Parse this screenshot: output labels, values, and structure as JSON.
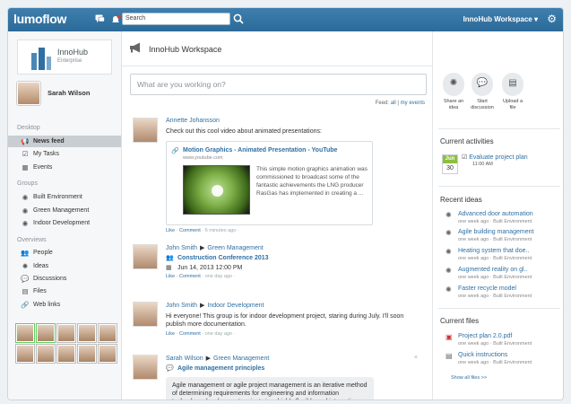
{
  "topbar": {
    "logo": "lumoflow",
    "search_placeholder": "Search",
    "workspace_menu": "InnoHub Workspace ▾",
    "notification_count": ""
  },
  "brand": {
    "name": "InnoHub",
    "sub": "Enterprise"
  },
  "user": {
    "name": "Sarah Wilson"
  },
  "nav": {
    "desktop_label": "Desktop",
    "desktop_items": [
      {
        "label": "News feed",
        "icon": "megaphone-icon"
      },
      {
        "label": "My Tasks",
        "icon": "check-icon"
      },
      {
        "label": "Events",
        "icon": "calendar-icon"
      }
    ],
    "groups_label": "Groups",
    "group_items": [
      {
        "label": "Built Environment"
      },
      {
        "label": "Green Management"
      },
      {
        "label": "Indoor Development"
      }
    ],
    "overviews_label": "Overviews",
    "overview_items": [
      {
        "label": "People",
        "icon": "people-icon"
      },
      {
        "label": "Ideas",
        "icon": "lightbulb-icon"
      },
      {
        "label": "Discussions",
        "icon": "chat-icon"
      },
      {
        "label": "Files",
        "icon": "file-icon"
      },
      {
        "label": "Web links",
        "icon": "link-icon"
      }
    ]
  },
  "main": {
    "workspace_title": "InnoHub Workspace",
    "post_placeholder": "What are you working on?",
    "feed_prefix": "Feed:",
    "feed_all": "all",
    "feed_sep": "|",
    "feed_my": "my events",
    "posts": [
      {
        "author": "Annette Johansson",
        "text": "Check out this cool video about animated presentations:",
        "link_title": "Motion Graphics - Animated Presentation - YouTube",
        "link_url": "www.youtube.com",
        "link_desc": "This simple motion graphics animation was commissioned to broadcast some of the fantastic achievements the LNG producer RasGas has implemented in creating a ...",
        "like": "Like",
        "comment": "Comment",
        "time": "· 6 minutes ago ·"
      },
      {
        "author": "John Smith",
        "group": "Green Management",
        "event_title": "Construction Conference 2013",
        "event_date": "Jun 14, 2013 12:00 PM",
        "like": "Like",
        "comment": "Comment",
        "time": "· one day ago ·"
      },
      {
        "author": "John Smith",
        "group": "Indoor Development",
        "text": "Hi everyone! This group is for indoor development project, staring during July. I'll soon publish more documentation.",
        "like": "Like",
        "comment": "Comment",
        "time": "· one day ago ·"
      },
      {
        "author": "Sarah Wilson",
        "group": "Green Management",
        "topic": "Agile management principles",
        "quote": "Agile management or agile project management is an iterative method of determining requirements for engineering and information technology development projects in a highly flexible and interactive",
        "close": "×"
      }
    ]
  },
  "right": {
    "actions": [
      {
        "label": "Share an idea",
        "icon": "lightbulb-icon"
      },
      {
        "label": "Start discussion",
        "icon": "chat-icon"
      },
      {
        "label": "Upload a file",
        "icon": "file-icon"
      }
    ],
    "current_activities_title": "Current activities",
    "activity": {
      "month": "Jun",
      "day": "30",
      "title": "Evaluate project plan",
      "time": "11:00 AM"
    },
    "recent_ideas_title": "Recent ideas",
    "ideas": [
      {
        "title": "Advanced door automation",
        "sub": "one week ago · Built Environment"
      },
      {
        "title": "Agile building management",
        "sub": "one week ago · Built Environment"
      },
      {
        "title": "Heating system that doe..",
        "sub": "one week ago · Built Environment"
      },
      {
        "title": "Augmented reality on gl..",
        "sub": "one week ago · Built Environment"
      },
      {
        "title": "Faster recycle model",
        "sub": "one week ago · Built Environment"
      }
    ],
    "current_files_title": "Current files",
    "files": [
      {
        "title": "Project plan 2.0.pdf",
        "sub": "one week ago · Built Environment"
      },
      {
        "title": "Quick instructions",
        "sub": "one week ago · Built Environment"
      }
    ],
    "show_all": "Show all files >>"
  }
}
